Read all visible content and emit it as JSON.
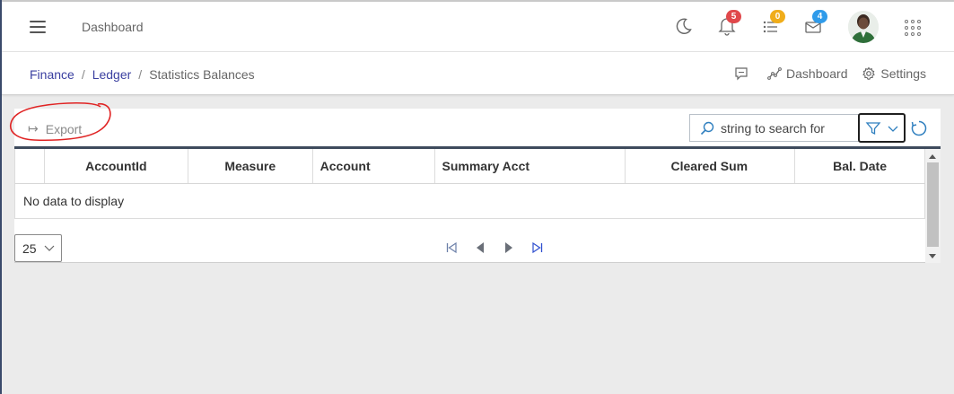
{
  "topbar": {
    "title": "Dashboard",
    "notifications_count": "5",
    "tasks_count": "0",
    "messages_count": "4",
    "badge_colors": {
      "notifications": "#e0484b",
      "tasks": "#f0ad1a",
      "messages": "#2f9bea"
    },
    "icons": [
      "menu-icon",
      "moon-icon",
      "bell-icon",
      "tasks-icon",
      "mail-icon",
      "apps-grid-icon"
    ]
  },
  "breadcrumb": {
    "items": [
      "Finance",
      "Ledger",
      "Statistics Balances"
    ],
    "separator": "/",
    "actions": {
      "dashboard_label": "Dashboard",
      "settings_label": "Settings"
    }
  },
  "toolbar": {
    "export_label": "Export",
    "search_placeholder": "string to search for"
  },
  "grid": {
    "columns": [
      "AccountId",
      "Measure",
      "Account",
      "Summary Acct",
      "Cleared Sum",
      "Bal. Date"
    ],
    "empty_text": "No data to display",
    "page_size": "25",
    "accent": "#3e4b5d",
    "link_color": "#3a3fa0"
  }
}
